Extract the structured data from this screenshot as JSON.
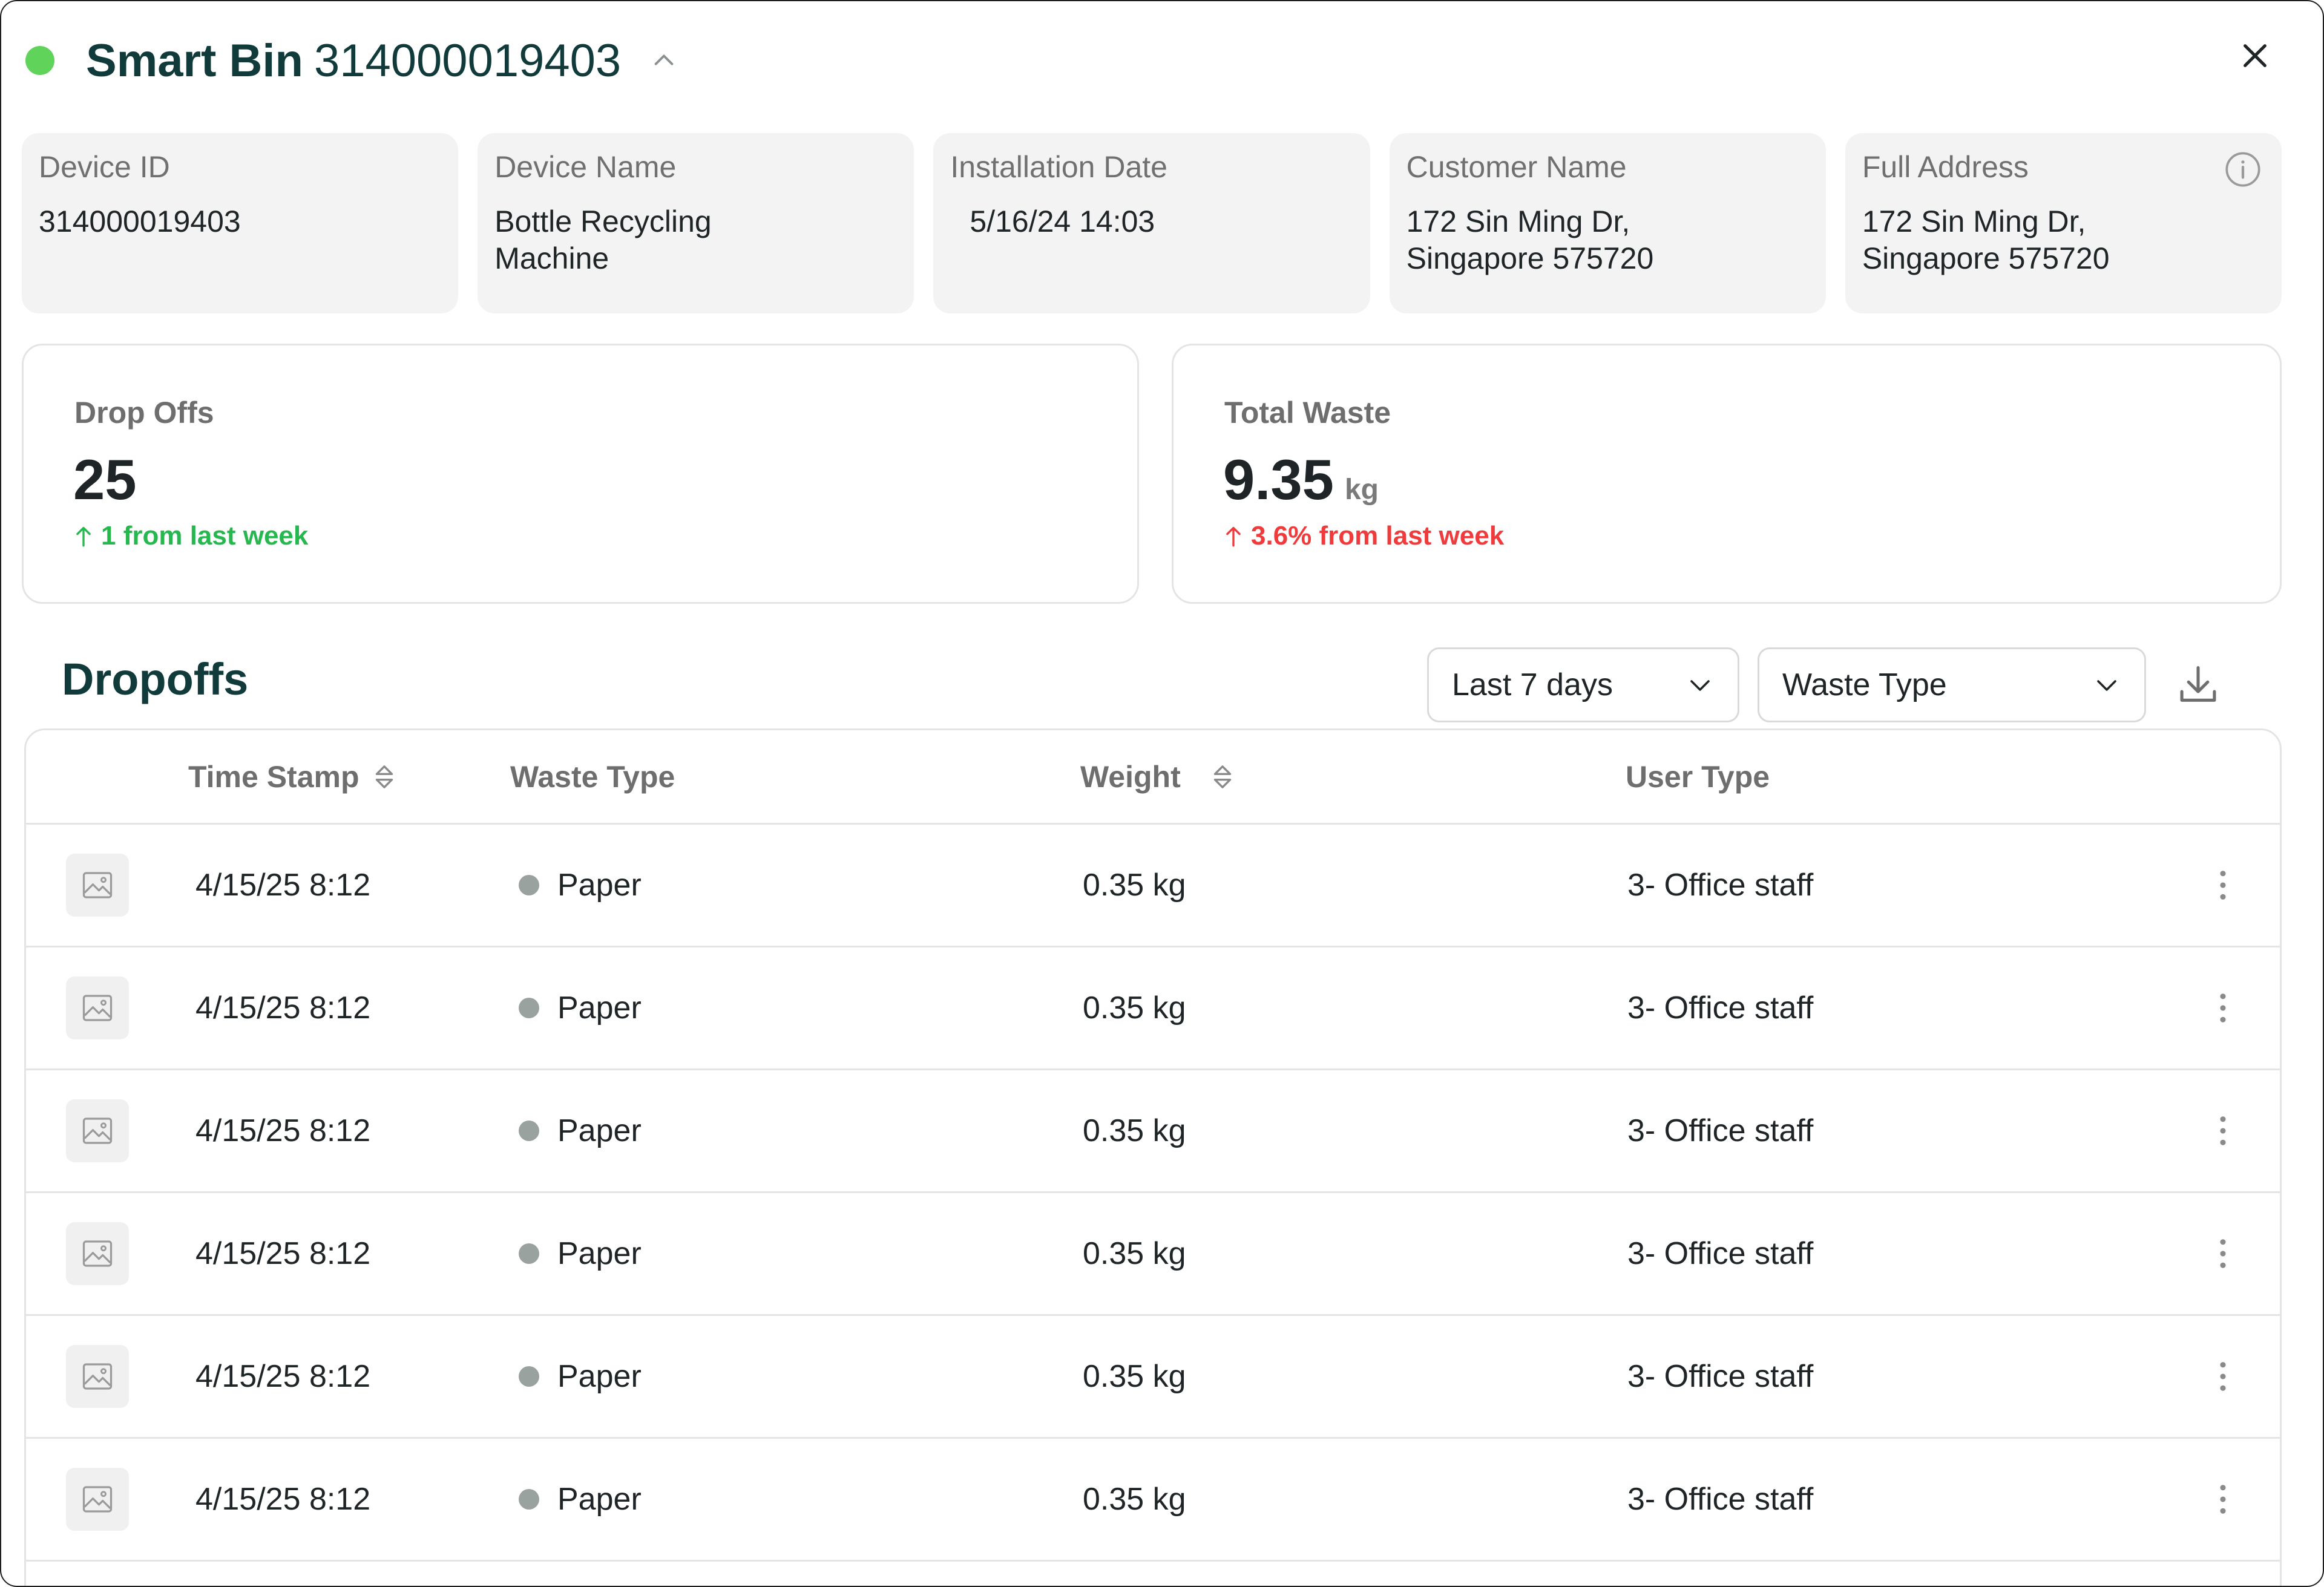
{
  "header": {
    "title_bold": "Smart Bin",
    "title_id": "314000019403",
    "status_color": "#5fd35a"
  },
  "info_cards": [
    {
      "label": "Device ID",
      "value": "314000019403"
    },
    {
      "label": "Device Name",
      "value": "Bottle Recycling\nMachine"
    },
    {
      "label": "Installation Date",
      "value": "5/16/24 14:03"
    },
    {
      "label": "Customer Name",
      "value": "172 Sin Ming Dr,\nSingapore 575720"
    },
    {
      "label": "Full Address",
      "value": "172 Sin Ming Dr,\nSingapore 575720"
    }
  ],
  "stats": {
    "drop_offs": {
      "label": "Drop Offs",
      "value": "25",
      "delta": "1 from last week",
      "delta_color": "#26b84e"
    },
    "total_waste": {
      "label": "Total Waste",
      "value": "9.35",
      "unit": "kg",
      "delta": "3.6% from last week",
      "delta_color": "#ef3b3b"
    }
  },
  "dropoffs": {
    "title": "Dropoffs",
    "range_filter": "Last 7 days",
    "waste_filter": "Waste Type",
    "columns": {
      "timestamp": "Time Stamp",
      "waste_type": "Waste Type",
      "weight": "Weight",
      "user_type": "User Type"
    },
    "rows": [
      {
        "timestamp": "4/15/25 8:12",
        "waste_type": "Paper",
        "weight": "0.35 kg",
        "user_type": "3- Office staff"
      },
      {
        "timestamp": "4/15/25 8:12",
        "waste_type": "Paper",
        "weight": "0.35 kg",
        "user_type": "3- Office staff"
      },
      {
        "timestamp": "4/15/25 8:12",
        "waste_type": "Paper",
        "weight": "0.35 kg",
        "user_type": "3- Office staff"
      },
      {
        "timestamp": "4/15/25 8:12",
        "waste_type": "Paper",
        "weight": "0.35 kg",
        "user_type": "3- Office staff"
      },
      {
        "timestamp": "4/15/25 8:12",
        "waste_type": "Paper",
        "weight": "0.35 kg",
        "user_type": "3- Office staff"
      },
      {
        "timestamp": "4/15/25 8:12",
        "waste_type": "Paper",
        "weight": "0.35 kg",
        "user_type": "3- Office staff"
      }
    ]
  }
}
